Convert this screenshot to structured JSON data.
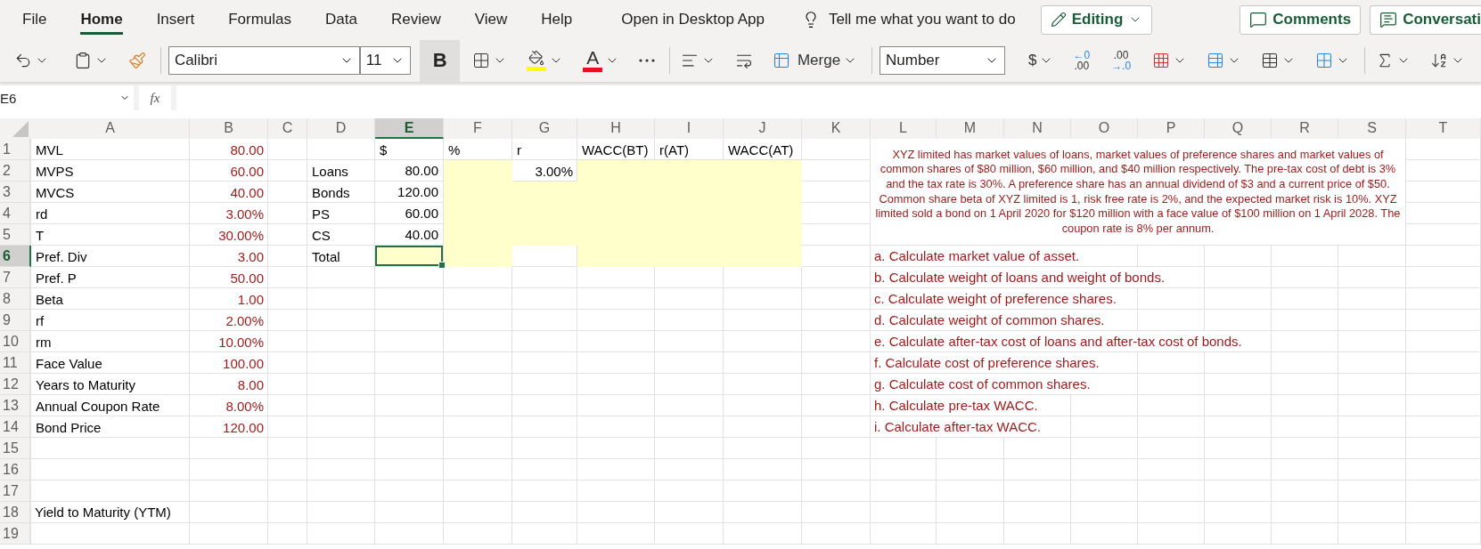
{
  "menu": {
    "tabs": [
      {
        "label": "File",
        "selected": false
      },
      {
        "label": "Home",
        "selected": true
      },
      {
        "label": "Insert",
        "selected": false
      },
      {
        "label": "Formulas",
        "selected": false
      },
      {
        "label": "Data",
        "selected": false
      },
      {
        "label": "Review",
        "selected": false
      },
      {
        "label": "View",
        "selected": false
      },
      {
        "label": "Help",
        "selected": false
      }
    ],
    "open_desktop": "Open in Desktop App",
    "tell_me": "Tell me what you want to do",
    "editing": "Editing",
    "comments": "Comments",
    "conversations": "Conversati"
  },
  "ribbon": {
    "font": "Calibri",
    "size": "11",
    "bold": "B",
    "bold_pressed": true,
    "font_color": "A",
    "merge": "Merge",
    "number_format": "Number",
    "currency": "$",
    "increase_decimal": {
      "top": "←0",
      "bottom": ".00"
    },
    "decrease_decimal": {
      "top": ".00",
      "bottom": "→.0"
    }
  },
  "formula_bar": {
    "name_box": "E6",
    "fx": "fx"
  },
  "sheet": {
    "columns": [
      {
        "label": "A",
        "selected": false
      },
      {
        "label": "B",
        "selected": false
      },
      {
        "label": "C",
        "selected": false
      },
      {
        "label": "D",
        "selected": false
      },
      {
        "label": "E",
        "selected": true
      },
      {
        "label": "F",
        "selected": false
      },
      {
        "label": "G",
        "selected": false
      },
      {
        "label": "H",
        "selected": false
      },
      {
        "label": "I",
        "selected": false
      },
      {
        "label": "J",
        "selected": false
      },
      {
        "label": "K",
        "selected": false
      },
      {
        "label": "L",
        "selected": false
      },
      {
        "label": "M",
        "selected": false
      },
      {
        "label": "N",
        "selected": false
      },
      {
        "label": "O",
        "selected": false
      },
      {
        "label": "P",
        "selected": false
      },
      {
        "label": "Q",
        "selected": false
      },
      {
        "label": "R",
        "selected": false
      },
      {
        "label": "S",
        "selected": false
      },
      {
        "label": "T",
        "selected": false
      }
    ],
    "rows": [
      {
        "label": "1",
        "selected": false
      },
      {
        "label": "2",
        "selected": false
      },
      {
        "label": "3",
        "selected": false
      },
      {
        "label": "4",
        "selected": false
      },
      {
        "label": "5",
        "selected": false
      },
      {
        "label": "6",
        "selected": true
      },
      {
        "label": "7",
        "selected": false
      },
      {
        "label": "8",
        "selected": false
      },
      {
        "label": "9",
        "selected": false
      },
      {
        "label": "10",
        "selected": false
      },
      {
        "label": "11",
        "selected": false
      },
      {
        "label": "12",
        "selected": false
      },
      {
        "label": "13",
        "selected": false
      },
      {
        "label": "14",
        "selected": false
      },
      {
        "label": "15",
        "selected": false
      },
      {
        "label": "16",
        "selected": false
      },
      {
        "label": "17",
        "selected": false
      },
      {
        "label": "18",
        "selected": false
      },
      {
        "label": "19",
        "selected": false
      }
    ],
    "inputs": [
      {
        "label": "MVL",
        "value": "80.00"
      },
      {
        "label": "MVPS",
        "value": "60.00"
      },
      {
        "label": "MVCS",
        "value": "40.00"
      },
      {
        "label": "rd",
        "value": "3.00%"
      },
      {
        "label": "T",
        "value": "30.00%"
      },
      {
        "label": "Pref. Div",
        "value": "3.00"
      },
      {
        "label": "Pref. P",
        "value": "50.00"
      },
      {
        "label": "Beta",
        "value": "1.00"
      },
      {
        "label": "rf",
        "value": "2.00%"
      },
      {
        "label": "rm",
        "value": "10.00%"
      },
      {
        "label": "Face Value",
        "value": "100.00"
      },
      {
        "label": "Years to Maturity",
        "value": "8.00"
      },
      {
        "label": "Annual Coupon Rate",
        "value": "8.00%"
      },
      {
        "label": "Bond Price",
        "value": "120.00"
      }
    ],
    "ytm_label": "Yield to Maturity (YTM)",
    "table_headers": [
      "$",
      "%",
      "r",
      "WACC(BT)",
      "r(AT)",
      "WACC(AT)"
    ],
    "table_rows": [
      {
        "label": "Loans",
        "amount": "80.00",
        "r": "3.00%",
        "amount_highlighted": false,
        "r_highlighted": false,
        "selected": false
      },
      {
        "label": "Bonds",
        "amount": "120.00",
        "amount_highlighted": false,
        "r_highlighted": true,
        "selected": false
      },
      {
        "label": "PS",
        "amount": "60.00",
        "amount_highlighted": false,
        "r_highlighted": true,
        "selected": false
      },
      {
        "label": "CS",
        "amount": "40.00",
        "amount_highlighted": false,
        "r_highlighted": true,
        "selected": false
      },
      {
        "label": "Total",
        "amount_highlighted": true,
        "r_highlighted": false,
        "selected": true
      }
    ],
    "problem": "XYZ limited has market values of loans, market values of preference shares and market values of common shares of $80 million, $60 million, and $40 million respectively. The pre-tax cost of debt is 3% and the tax rate is 30%. A preference share has an annual dividend of $3 and a current price of $50. Common share beta of XYZ limited is 1, risk free rate is 2%, and the expected market risk is 10%. XYZ limited sold a bond on 1 April 2020 for $120 million with a face value of $100 million on 1 April 2028. The coupon rate is 8% per annum.",
    "tasks": [
      "a. Calculate market value of asset.",
      "b. Calculate weight of loans and weight of bonds.",
      "c. Calculate weight of preference shares.",
      "d. Calculate weight of common shares.",
      "e. Calculate after-tax cost of loans and after-tax cost of bonds.",
      "f. Calculate cost of preference shares.",
      "g. Calculate cost of common shares.",
      "h. Calculate pre-tax WACC.",
      "i. Calculate after-tax WACC."
    ]
  }
}
